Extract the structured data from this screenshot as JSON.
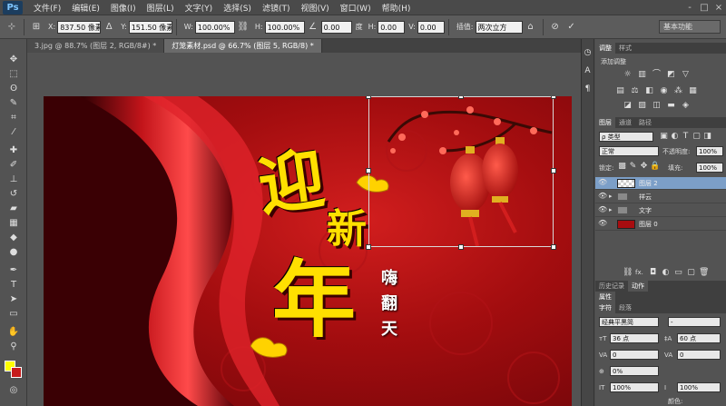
{
  "app": {
    "logo": "Ps"
  },
  "menu": [
    "文件(F)",
    "编辑(E)",
    "图像(I)",
    "图层(L)",
    "文字(Y)",
    "选择(S)",
    "滤镜(T)",
    "视图(V)",
    "窗口(W)",
    "帮助(H)"
  ],
  "window_controls": [
    "-",
    "□",
    "×"
  ],
  "options_bar": {
    "x_label": "X:",
    "x_value": "837.50 像素",
    "y_label": "Y:",
    "y_value": "151.50 像素",
    "w_label": "W:",
    "w_value": "100.00%",
    "h_label": "H:",
    "h_value": "100.00%",
    "angle_value": "0.00",
    "angle_unit": "度",
    "hskew_label": "H:",
    "hskew_value": "0.00",
    "vskew_label": "V:",
    "vskew_value": "0.00",
    "interp_label": "插值:",
    "interp_value": "两次立方",
    "workspace": "基本功能"
  },
  "tabs": [
    {
      "label": "3.jpg @ 88.7% (图层 2, RGB/8#) *",
      "active": false
    },
    {
      "label": "灯笼素材.psd @ 66.7% (图层 5, RGB/8) *",
      "active": true
    }
  ],
  "tools": [
    "move-tool-icon",
    "marquee-tool-icon",
    "lasso-tool-icon",
    "quick-select-icon",
    "crop-tool-icon",
    "eyedropper-icon",
    "healing-brush-icon",
    "brush-tool-icon",
    "clone-stamp-icon",
    "history-brush-icon",
    "eraser-icon",
    "gradient-tool-icon",
    "blur-tool-icon",
    "dodge-tool-icon",
    "pen-tool-icon",
    "type-tool-icon",
    "path-select-icon",
    "shape-tool-icon",
    "hand-tool-icon",
    "zoom-tool-icon"
  ],
  "colors": {
    "foreground": "#ffff00",
    "background": "#c61c1c"
  },
  "artwork": {
    "chars_big": [
      "迎",
      "新",
      "年"
    ],
    "chars_small": [
      "嗨",
      "翻",
      "天"
    ]
  },
  "adjust_panel": {
    "tabs": [
      "调整",
      "样式"
    ],
    "subtitle": "添加调整"
  },
  "layers_panel": {
    "tabs": [
      "图层",
      "通道",
      "路径"
    ],
    "filter_kind": "ρ 类型",
    "blend_mode": "正常",
    "opacity_label": "不透明度:",
    "opacity_value": "100%",
    "lock_label": "锁定:",
    "fill_label": "填充:",
    "fill_value": "100%",
    "layers": [
      {
        "name": "图层 2",
        "type": "image",
        "selected": true
      },
      {
        "name": "祥云",
        "type": "group",
        "selected": false
      },
      {
        "name": "文字",
        "type": "group",
        "selected": false
      },
      {
        "name": "图层 0",
        "type": "image",
        "selected": false
      }
    ],
    "footer_icons": [
      "link-icon",
      "fx-icon",
      "mask-icon",
      "adjustment-icon",
      "folder-icon",
      "new-layer-icon",
      "trash-icon"
    ],
    "fx_label": "fx."
  },
  "history_panel": {
    "tabs": [
      "历史记录",
      "动作"
    ]
  },
  "properties_panel": {
    "tabs": [
      "属性"
    ]
  },
  "character_panel": {
    "tabs": [
      "字符",
      "段落"
    ],
    "font_family": "经典平黑简",
    "font_style": "-",
    "font_size": "36 点",
    "leading": "60 点",
    "kerning": "0",
    "tracking": "0",
    "scale_pct": "0%",
    "vscale": "100%",
    "hscale": "100%",
    "color_label": "颜色:"
  }
}
